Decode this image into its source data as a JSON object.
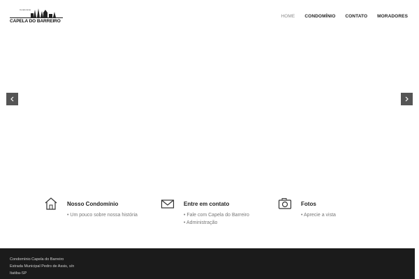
{
  "header": {
    "logo": {
      "small_text": "Condomínio",
      "name": "CAPELA DO BARREIRO"
    },
    "nav": [
      {
        "label": "HOME",
        "active": true
      },
      {
        "label": "CONDOMÍNIO",
        "active": false
      },
      {
        "label": "CONTATO",
        "active": false
      },
      {
        "label": "MORADORES",
        "active": false
      }
    ]
  },
  "slider": {
    "prev_icon": "chevron-left-icon",
    "next_icon": "chevron-right-icon"
  },
  "features": [
    {
      "icon": "home-icon",
      "title": "Nosso Condomínio",
      "links": [
        "• Um pouco sobre nossa história"
      ]
    },
    {
      "icon": "mail-icon",
      "title": "Entre em contato",
      "links": [
        "• Fale com Capela do Barreiro",
        "• Administração"
      ]
    },
    {
      "icon": "camera-icon",
      "title": "Fotos",
      "links": [
        "• Aprecie a vista"
      ]
    }
  ],
  "footer": {
    "lines": [
      "Condomínio Capela do Barreiro",
      "Estrada Municipal Pedro de Assis, s/n",
      "Itatiba-SP"
    ]
  },
  "colors": {
    "footer_bg": "#1b1b1b",
    "arrow_bg": "#555555",
    "nav_active": "#888888"
  }
}
